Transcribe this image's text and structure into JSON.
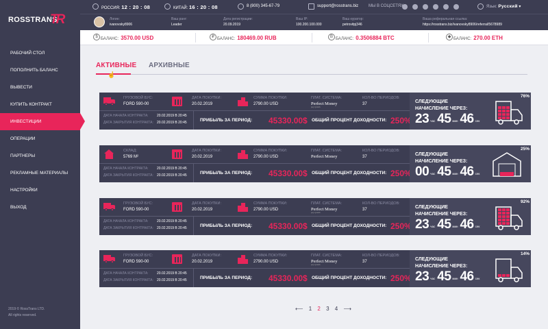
{
  "brand": {
    "name": "ROSSTRANS",
    "mark": "TR"
  },
  "sidebar": {
    "items": [
      {
        "label": "РАБОЧИЙ СТОЛ",
        "active": false
      },
      {
        "label": "ПОПОЛНИТЬ БАЛАНС",
        "active": false
      },
      {
        "label": "ВЫВЕСТИ",
        "active": false
      },
      {
        "label": "КУПИТЬ КОНТРАКТ",
        "active": false
      },
      {
        "label": "ИНВЕСТИЦИИ",
        "active": true
      },
      {
        "label": "ОПЕРАЦИИ",
        "active": false
      },
      {
        "label": "ПАРТНЕРЫ",
        "active": false
      },
      {
        "label": "РЕКЛАМНЫЕ МАТЕРИАЛЫ",
        "active": false
      },
      {
        "label": "НАСТРОЙКИ",
        "active": false
      },
      {
        "label": "ВЫХОД",
        "active": false
      }
    ],
    "copyright": "2019 © RossTrans LTD.",
    "rights": "All rights reserved."
  },
  "topbar": {
    "russia_label": "РОССИЯ:",
    "russia_time": "12 : 20 : 08",
    "china_label": "КИТАЙ:",
    "china_time": "16 : 20 : 08",
    "phone": "8 (800) 345-67-79",
    "email": "support@rosstrans.biz",
    "social_label": "МЫ В СОЦСЕТЯХ:",
    "language_label": "Язык:",
    "language": "Русский"
  },
  "user": {
    "login_label": "Логин:",
    "login": "ivanovsky8906",
    "rank_label": "Ваш ранг:",
    "rank": "Leader",
    "reg_label": "Дата регистрации:",
    "reg": "20.09.2019",
    "ip_label": "Ваш IP:",
    "ip": "100.200.100.000",
    "curator_label": "Ваш куратор:",
    "curator": "petrovitpj346",
    "ref_label": "Ваша реферальная ссылка:",
    "ref": "https://rosstrans.biz/ivanovsky8906/referral/5678989"
  },
  "balances": [
    {
      "label": "БАЛАНС:",
      "amount": "3570.00 USD",
      "icon": "$"
    },
    {
      "label": "БАЛАНС:",
      "amount": "180469.00 RUB",
      "icon": "₽"
    },
    {
      "label": "БАЛАНС:",
      "amount": "0.3506884 BTC",
      "icon": "B"
    },
    {
      "label": "БАЛАНС:",
      "amount": "270.00 ETH",
      "icon": "◆"
    }
  ],
  "tabs": {
    "active": "АКТИВНЫЕ",
    "archive": "АРХИВНЫЕ"
  },
  "card_labels": {
    "purchase_date": "ДАТА ПОКУПКИ:",
    "purchase_sum": "СУММА ПОКУПКИ:",
    "pay_system": "ПЛАТ. СИСТЕМА:",
    "periods": "КОЛ-ВО ПЕРИОДОВ:",
    "start": "ДАТА НАЧАЛА КОНТРАКТА:",
    "end": "ДАТА ЗАКРЫТИЯ КОНТРАКТА:",
    "profit": "ПРИБЫЛЬ ЗА ПЕРИОД:",
    "yield": "ОБЩИЙ ПРОЦЕНТ ДОХОДНОСТИ:",
    "next": "СЛЕДУЮЩИЕ НАЧИСЛЕНИЕ ЧЕРЕЗ:",
    "h": "час",
    "m": "мин",
    "s": "сек"
  },
  "cards": [
    {
      "type_label": "ГРУЗОВОЙ БУС:",
      "type_value": "FORD 590-00",
      "icon": "truck",
      "date": "20.02.2019",
      "sum": "2790.00 USD",
      "pay_top": "Perfect Money",
      "pay_sub": "pay system",
      "periods": "37",
      "start": "20.02.2019 В 20:45",
      "end": "20.02.2019 В 20:45",
      "profit": "45330.00$",
      "yield": "250%",
      "hours": "23",
      "minutes": "45",
      "seconds": "46",
      "progress": "76%",
      "fill": 0.76
    },
    {
      "type_label": "СКЛАД:",
      "type_value": "5769 М²",
      "icon": "warehouse",
      "date": "20.02.2019",
      "sum": "2790.00 USD",
      "pay_top": "Perfect Money",
      "pay_sub": "",
      "periods": "37",
      "start": "20.02.2019 В 20:45",
      "end": "20.02.2019 В 20:45",
      "profit": "45330.00$",
      "yield": "250%",
      "hours": "00",
      "minutes": "45",
      "seconds": "46",
      "progress": "25%",
      "fill": 0.25
    },
    {
      "type_label": "ГРУЗОВОЙ БУС:",
      "type_value": "FORD 590-00",
      "icon": "truck",
      "date": "20.02.2019",
      "sum": "2790.00 USD",
      "pay_top": "Perfect Money",
      "pay_sub": "pay system",
      "periods": "37",
      "start": "20.02.2019 В 20:45",
      "end": "20.02.2019 В 20:45",
      "profit": "45330.00$",
      "yield": "250%",
      "hours": "23",
      "minutes": "45",
      "seconds": "46",
      "progress": "92%",
      "fill": 0.92
    },
    {
      "type_label": "ГРУЗОВОЙ БУС:",
      "type_value": "FORD 590-00",
      "icon": "truck",
      "date": "20.02.2019",
      "sum": "2790.00 USD",
      "pay_top": "Perfect Money",
      "pay_sub": "pay system",
      "periods": "37",
      "start": "20.02.2019 В 20:45",
      "end": "20.02.2019 В 20:45",
      "profit": "45330.00$",
      "yield": "250%",
      "hours": "23",
      "minutes": "45",
      "seconds": "46",
      "progress": "14%",
      "fill": 0.14
    }
  ],
  "pager": {
    "prev": "⟵",
    "pages": [
      "1",
      "2",
      "3",
      "4"
    ],
    "current": "2",
    "next": "⟶"
  },
  "colors": {
    "accent": "#e8255a",
    "dark": "#3c3d52",
    "bg": "#eeeff3"
  }
}
